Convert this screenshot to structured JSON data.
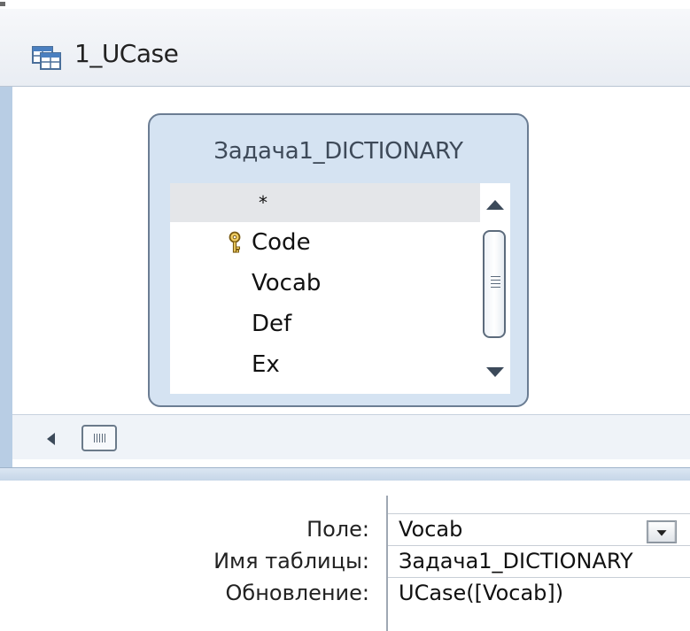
{
  "window": {
    "title": "1_UCase",
    "icon": "query-icon"
  },
  "table": {
    "name": "Задача1_DICTIONARY",
    "fields": [
      {
        "label": "*",
        "primary_key": false,
        "selected": true
      },
      {
        "label": "Code",
        "primary_key": true,
        "selected": false
      },
      {
        "label": "Vocab",
        "primary_key": false,
        "selected": false
      },
      {
        "label": "Def",
        "primary_key": false,
        "selected": false
      },
      {
        "label": "Ex",
        "primary_key": false,
        "selected": false
      }
    ]
  },
  "grid": {
    "labels": {
      "field": "Поле:",
      "table": "Имя таблицы:",
      "update": "Обновление:"
    },
    "column": {
      "field": "Vocab",
      "table": "Задача1_DICTIONARY",
      "update": "UCase([Vocab])"
    }
  },
  "colors": {
    "accent_blue": "#b8cde4",
    "table_box_bg": "#d5e3f2",
    "selected_row": "#e4e6e9"
  }
}
